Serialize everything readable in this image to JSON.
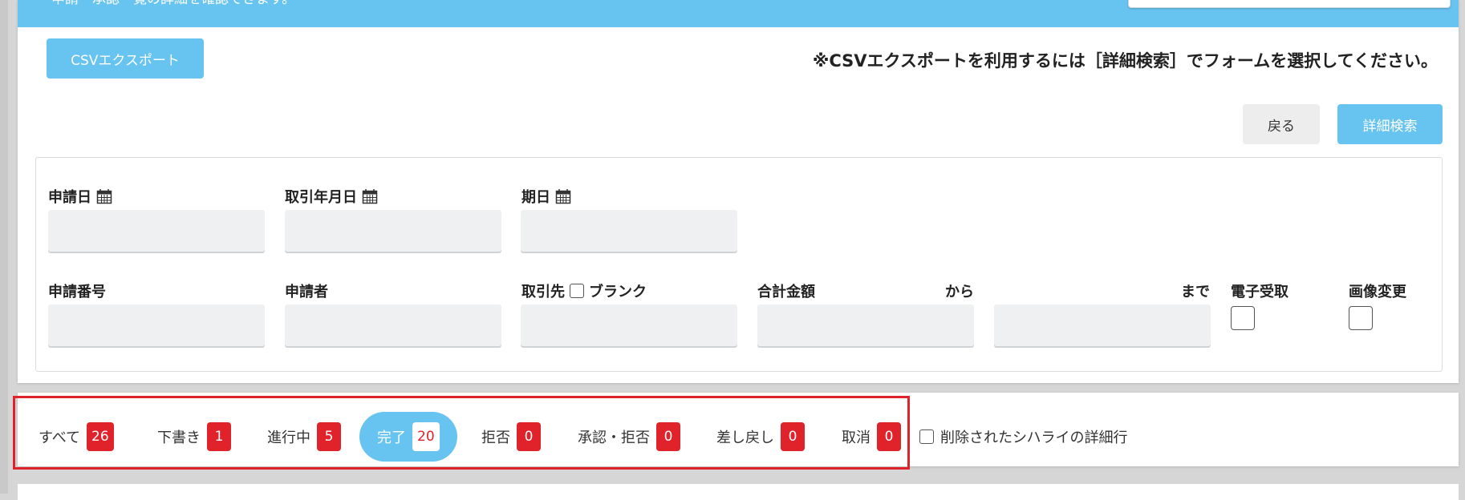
{
  "header": {
    "description": "申請・承認一覧の詳細を確認できます。"
  },
  "toolbar": {
    "csv_export_label": "CSVエクスポート",
    "csv_notice": "※CSVエクスポートを利用するには［詳細検索］でフォームを選択してください。",
    "back_label": "戻る",
    "advanced_search_label": "詳細検索"
  },
  "filters": {
    "application_date_label": "申請日",
    "transaction_date_label": "取引年月日",
    "due_date_label": "期日",
    "application_number_label": "申請番号",
    "applicant_label": "申請者",
    "client_label": "取引先",
    "blank_label": "ブランク",
    "total_amount_label": "合計金額",
    "from_label": "から",
    "to_label": "まで",
    "electronic_receipt_label": "電子受取",
    "image_change_label": "画像変更"
  },
  "tabs": [
    {
      "label": "すべて",
      "count": "26"
    },
    {
      "label": "下書き",
      "count": "1"
    },
    {
      "label": "進行中",
      "count": "5"
    },
    {
      "label": "完了",
      "count": "20"
    },
    {
      "label": "拒否",
      "count": "0"
    },
    {
      "label": "承認・拒否",
      "count": "0"
    },
    {
      "label": "差し戻し",
      "count": "0"
    },
    {
      "label": "取消",
      "count": "0"
    }
  ],
  "active_tab": "完了",
  "deleted_rows_label": "削除されたシハライの詳細行",
  "colors": {
    "accent": "#67c3f0",
    "badge": "#e0222b",
    "highlight_border": "#e0222b"
  },
  "icons": {
    "calendar": "calendar-icon"
  }
}
